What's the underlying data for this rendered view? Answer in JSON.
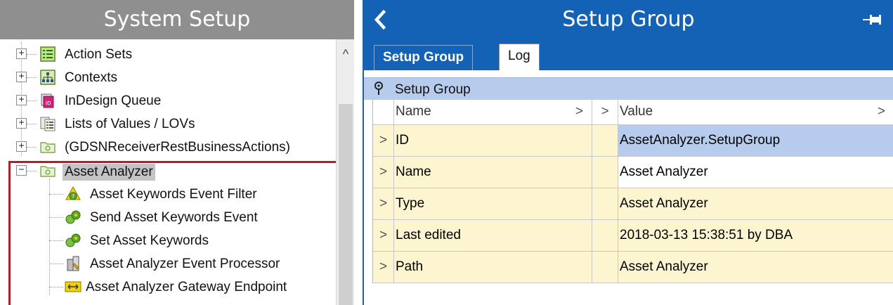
{
  "left_panel": {
    "title": "System Setup",
    "tree": [
      {
        "label": "Action Sets",
        "icon": "action-sets-icon"
      },
      {
        "label": "Contexts",
        "icon": "contexts-icon"
      },
      {
        "label": "InDesign Queue",
        "icon": "indesign-queue-icon"
      },
      {
        "label": "Lists of Values / LOVs",
        "icon": "lov-icon"
      },
      {
        "label": "(GDSNReceiverRestBusinessActions)",
        "icon": "folder-icon"
      },
      {
        "label": "Asset Analyzer",
        "icon": "folder-icon",
        "selected": true,
        "expanded": true
      }
    ],
    "children": [
      {
        "label": "Asset Keywords Event Filter",
        "icon": "event-filter-icon"
      },
      {
        "label": "Send Asset Keywords Event",
        "icon": "event-action-icon"
      },
      {
        "label": "Set Asset Keywords",
        "icon": "event-action-icon"
      },
      {
        "label": "Asset Analyzer Event Processor",
        "icon": "event-processor-icon"
      },
      {
        "label": "Asset Analyzer Gateway Endpoint",
        "icon": "gateway-endpoint-icon"
      }
    ],
    "expand_symbol": "+",
    "collapse_symbol": "−",
    "scroll_up": "^"
  },
  "right_panel": {
    "title": "Setup Group",
    "back_symbol": "<",
    "tabs": [
      {
        "label": "Setup Group",
        "active": true
      },
      {
        "label": "Log",
        "active": false
      }
    ],
    "group_label": "Setup Group",
    "grid_header": {
      "name": "Name",
      "value": "Value",
      "arrow": ">"
    },
    "rows": [
      {
        "name": "ID",
        "value": "AssetAnalyzer.SetupGroup"
      },
      {
        "name": "Name",
        "value": "Asset Analyzer"
      },
      {
        "name": "Type",
        "value": "Asset Analyzer"
      },
      {
        "name": "Last edited",
        "value": "2018-03-13 15:38:51 by DBA"
      },
      {
        "name": "Path",
        "value": "Asset Analyzer"
      }
    ],
    "row_arrow": ">"
  },
  "colors": {
    "header_blue": "#1462b6",
    "left_header_gray": "#8f8f8f",
    "highlight_red": "#b0202a",
    "row_yellow": "#fcf5cf",
    "row_blue": "#b7ccec"
  }
}
